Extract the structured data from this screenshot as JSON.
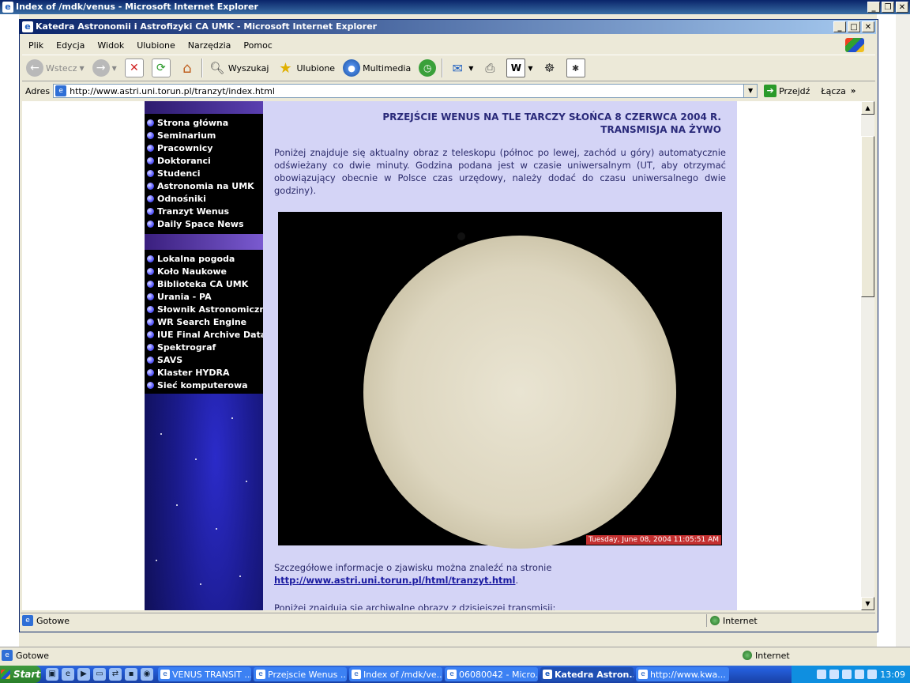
{
  "background_window": {
    "title": "Index of /mdk/venus - Microsoft Internet Explorer",
    "status": "Gotowe",
    "zone": "Internet"
  },
  "window": {
    "title": "Katedra Astronomii i Astrofizyki CA UMK - Microsoft Internet Explorer",
    "menu": [
      "Plik",
      "Edycja",
      "Widok",
      "Ulubione",
      "Narzędzia",
      "Pomoc"
    ],
    "toolbar": {
      "back": "Wstecz",
      "search": "Wyszukaj",
      "favorites": "Ulubione",
      "media": "Multimedia"
    },
    "address_label": "Adres",
    "url": "http://www.astri.uni.torun.pl/tranzyt/index.html",
    "go_label": "Przejdź",
    "links_label": "Łącza",
    "status": "Gotowe",
    "zone": "Internet"
  },
  "nav": {
    "group1": [
      "Strona główna",
      "Seminarium",
      "Pracownicy",
      "Doktoranci",
      "Studenci",
      "Astronomia na UMK",
      "Odnośniki",
      "Tranzyt Wenus",
      "Daily Space News"
    ],
    "group2": [
      "Lokalna pogoda",
      "Koło Naukowe",
      "Biblioteka CA UMK",
      "Urania - PA",
      "Słownik Astronomiczny",
      "WR Search Engine",
      "IUE Final Archive Data",
      "Spektrograf",
      "SAVS",
      "Klaster HYDRA",
      "Sieć komputerowa"
    ]
  },
  "content": {
    "heading_line1": "PRZEJŚCIE WENUS NA TLE TARCZY SŁOŃCA 8 CZERWCA 2004 R.",
    "heading_line2": "TRANSMISJA NA ŻYWO",
    "intro": "Poniżej znajduje się aktualny obraz z teleskopu (północ po lewej, zachód u góry) automatycznie odświeżany co dwie minuty. Godzina podana jest w czasie uniwersalnym (UT, aby otrzymać obowiązujący obecnie w Polsce czas urzędowy, należy dodać do czasu uniwersalnego dwie godziny).",
    "timestamp": "Tuesday, June 08, 2004  11:05:51 AM",
    "details_text": "Szczegółowe informacje o zjawisku można znaleźć na stronie",
    "details_link": "http://www.astri.uni.torun.pl/html/tranzyt.html",
    "details_end": ".",
    "archive_text": "Poniżej znajdują się archiwalne obrazy z dzisiejszej transmisji:"
  },
  "taskbar": {
    "start": "Start",
    "tasks": [
      "VENUS TRANSIT ...",
      "Przejscie Wenus ...",
      "Index of /mdk/ve...",
      "06080042 - Micro...",
      "Katedra Astron...",
      "http://www.kwa..."
    ],
    "active_index": 4,
    "clock": "13:09"
  }
}
